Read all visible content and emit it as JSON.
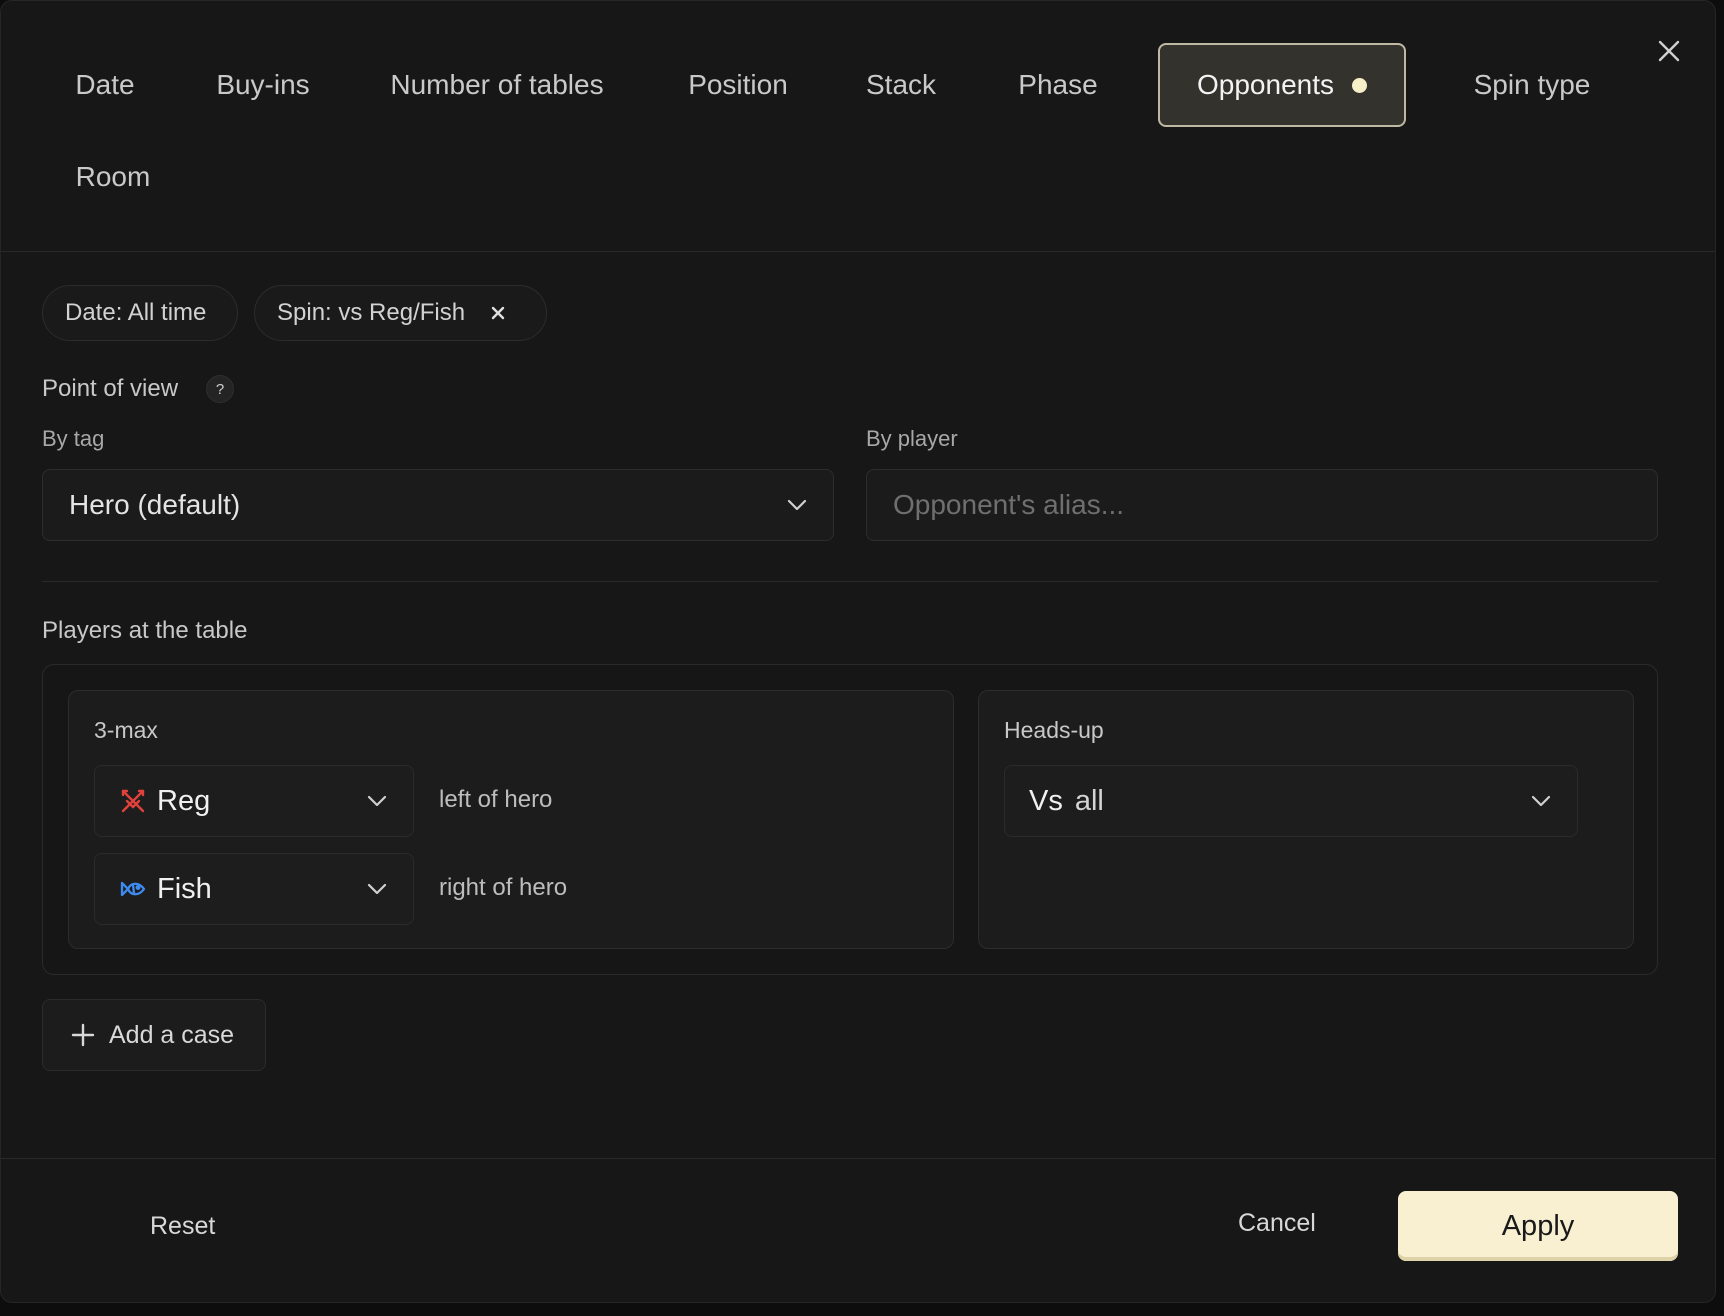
{
  "tabs": [
    {
      "label": "Date",
      "active": false
    },
    {
      "label": "Buy-ins",
      "active": false
    },
    {
      "label": "Number of tables",
      "active": false
    },
    {
      "label": "Position",
      "active": false
    },
    {
      "label": "Stack",
      "active": false
    },
    {
      "label": "Phase",
      "active": false
    },
    {
      "label": "Opponents",
      "active": true
    },
    {
      "label": "Spin type",
      "active": false
    },
    {
      "label": "Room",
      "active": false
    }
  ],
  "chips": [
    {
      "label": "Date: All time",
      "removable": false
    },
    {
      "label": "Spin: vs Reg/Fish",
      "removable": true
    }
  ],
  "point_of_view": {
    "title": "Point of view",
    "help": "?",
    "by_tag_label": "By tag",
    "by_tag_value": "Hero (default)",
    "by_player_label": "By player",
    "by_player_placeholder": "Opponent's alias..."
  },
  "players": {
    "title": "Players at the table",
    "three_max": {
      "title": "3-max",
      "rows": [
        {
          "role": "Reg",
          "icon": "swords-icon",
          "icon_color": "#e0413a",
          "desc": "left of hero"
        },
        {
          "role": "Fish",
          "icon": "fish-icon",
          "icon_color": "#3d8bf0",
          "desc": "right of hero"
        }
      ]
    },
    "heads_up": {
      "title": "Heads-up",
      "prefix": "Vs",
      "value": "all"
    }
  },
  "add_case_label": "Add a case",
  "footer": {
    "reset": "Reset",
    "cancel": "Cancel",
    "apply": "Apply"
  },
  "colors": {
    "accent": "#f8f0d0",
    "active_dot": "#f7efc8",
    "reg_icon": "#e0413a",
    "fish_icon": "#3d8bf0"
  }
}
